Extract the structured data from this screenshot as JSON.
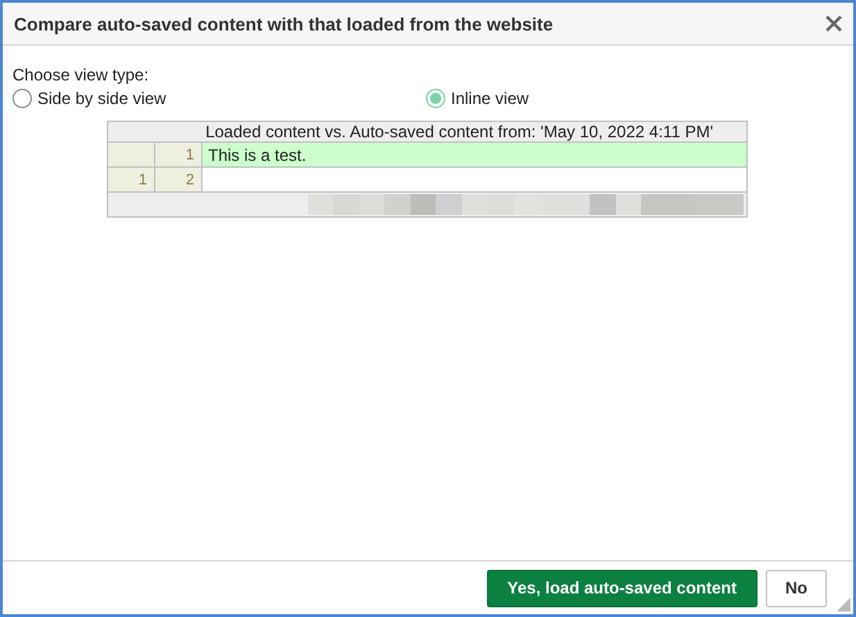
{
  "window": {
    "title": "Compare auto-saved content with that loaded from the website"
  },
  "view_type": {
    "label": "Choose view type:",
    "options": [
      {
        "label": "Side by side view",
        "selected": false
      },
      {
        "label": "Inline view",
        "selected": true
      }
    ]
  },
  "diff": {
    "header": "Loaded content vs. Auto-saved content from: 'May 10, 2022 4:11 PM'",
    "rows": [
      {
        "old": "",
        "new": "1",
        "text": "This is a test.",
        "kind": "insert"
      },
      {
        "old": "1",
        "new": "2",
        "text": "",
        "kind": "equal"
      }
    ]
  },
  "buttons": [
    {
      "label": "Yes, load auto-saved content",
      "kind": "primary"
    },
    {
      "label": "No",
      "kind": "secondary"
    }
  ]
}
